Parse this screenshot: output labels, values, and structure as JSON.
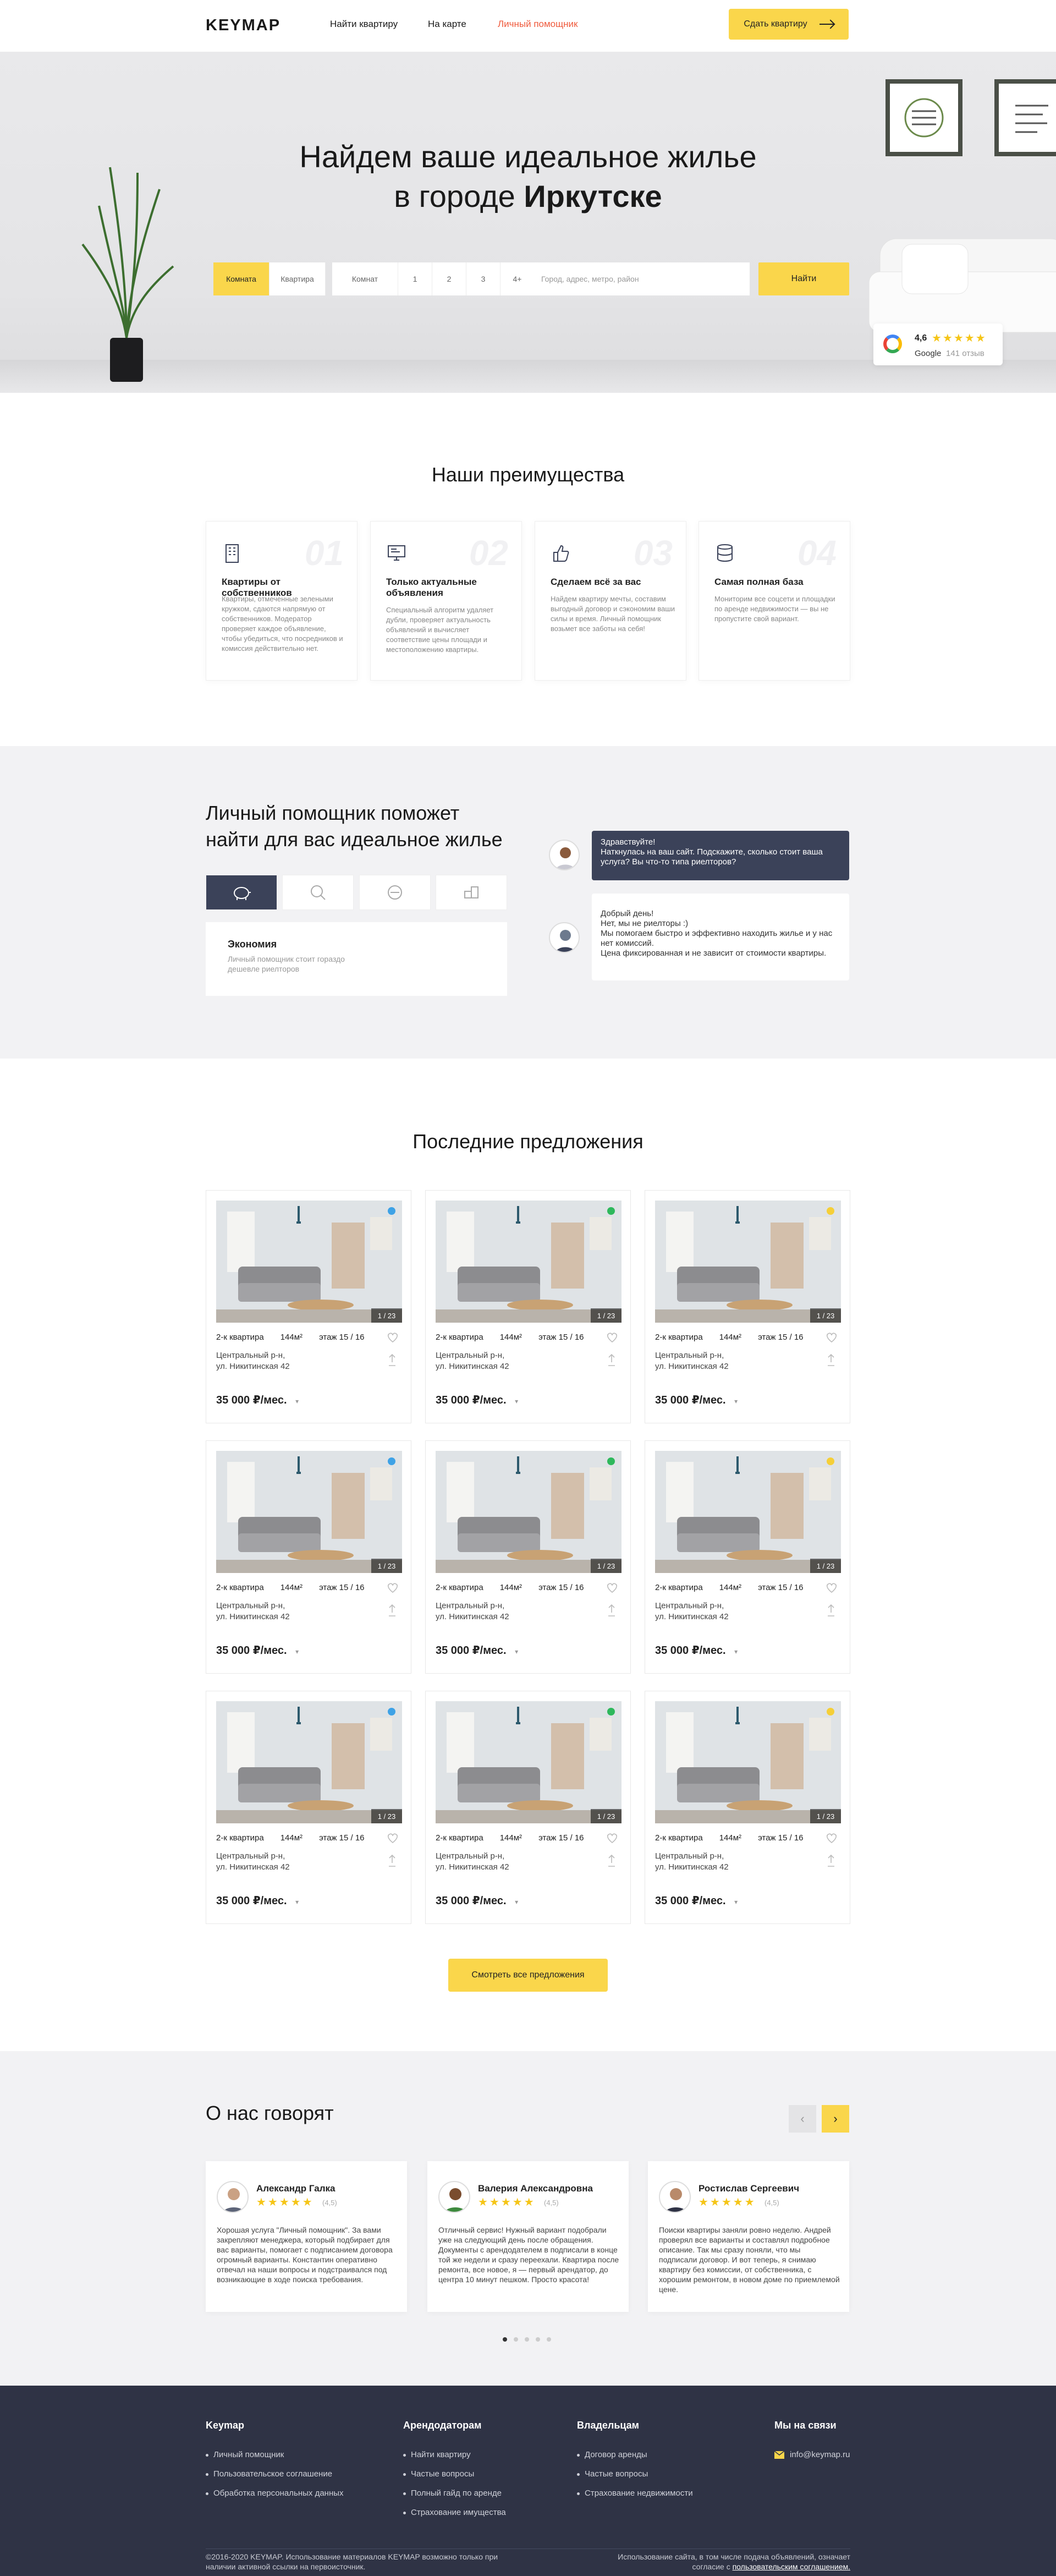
{
  "header": {
    "logo": "KEYMAP",
    "nav": [
      "Найти квартиру",
      "На карте",
      "Личный помощник"
    ],
    "rent_button": "Сдать квартиру"
  },
  "hero": {
    "title_line1": "Найдем ваше идеальное жилье",
    "title_line2_prefix": "в городе ",
    "city": "Иркутске",
    "search": {
      "type_options": [
        "Комната",
        "Квартира"
      ],
      "rooms_label": "Комнат",
      "rooms": [
        "1",
        "2",
        "3",
        "4+"
      ],
      "placeholder": "Город, адрес, метро, район",
      "button": "Найти"
    },
    "google": {
      "rating": "4,6",
      "stars": "★★★★★",
      "name": "Google",
      "reviews": "141 отзыв"
    }
  },
  "advantages": {
    "title": "Наши преимущества",
    "items": [
      {
        "num": "01",
        "title": "Квартиры от собственников",
        "text": "Квартиры, отмеченные зелеными кружком, сдаются напрямую от собственников. Модератор проверяет каждое объявление, чтобы убедиться, что посредников и комиссия действительно нет."
      },
      {
        "num": "02",
        "title": "Только актуальные объявления",
        "text": "Специальный алгоритм удаляет дубли, проверяет актуальность объявлений и вычисляет соответствие цены площади и местоположению квартиры."
      },
      {
        "num": "03",
        "title": "Сделаем всё за вас",
        "text": "Найдем квартиру мечты, составим выгодный договор и сэкономим ваши силы и время. Личный помощник возьмет все заботы на себя!"
      },
      {
        "num": "04",
        "title": "Самая полная база",
        "text": "Мониторим все соцсети и площадки по аренде недвижимости — вы не пропустите свой вариант."
      }
    ]
  },
  "assistant": {
    "title_line1": "Личный помощник поможет",
    "title_line2": "найти для вас идеальное жилье",
    "active_title": "Экономия",
    "active_text": "Личный помощник стоит гораздо дешевле риелторов",
    "question": "Здравствуйте!\nНаткнулась на ваш сайт. Подскажите, сколько стоит ваша услуга? Вы что-то типа риелторов?",
    "answer": "Добрый день!\nНет, мы не риелторы :)\nМы помогаем быстро и эффективно находить жилье и у нас нет комиссий.\nЦена фиксированная и не зависит от стоимости квартиры."
  },
  "offers": {
    "title": "Последние предложения",
    "more_button": "Смотреть все предложения",
    "cards": [
      {
        "rooms": "2-к квартира",
        "area": "144м²",
        "floor": "этаж 15 / 16",
        "district": "Центральный р-н,",
        "street": "ул. Никитинская 42",
        "price": "35 000  ₽/мес.",
        "photos": "1 / 23",
        "dot": "#3ea2e6"
      },
      {
        "rooms": "2-к квартира",
        "area": "144м²",
        "floor": "этаж 15 / 16",
        "district": "Центральный р-н,",
        "street": "ул. Никитинская 42",
        "price": "35 000  ₽/мес.",
        "photos": "1 / 23",
        "dot": "#2eb85c"
      },
      {
        "rooms": "2-к квартира",
        "area": "144м²",
        "floor": "этаж 15 / 16",
        "district": "Центральный р-н,",
        "street": "ул. Никитинская 42",
        "price": "35 000  ₽/мес.",
        "photos": "1 / 23",
        "dot": "#f5cf38"
      },
      {
        "rooms": "2-к квартира",
        "area": "144м²",
        "floor": "этаж 15 / 16",
        "district": "Центральный р-н,",
        "street": "ул. Никитинская 42",
        "price": "35 000  ₽/мес.",
        "photos": "1 / 23",
        "dot": "#3ea2e6"
      },
      {
        "rooms": "2-к квартира",
        "area": "144м²",
        "floor": "этаж 15 / 16",
        "district": "Центральный р-н,",
        "street": "ул. Никитинская 42",
        "price": "35 000  ₽/мес.",
        "photos": "1 / 23",
        "dot": "#2eb85c"
      },
      {
        "rooms": "2-к квартира",
        "area": "144м²",
        "floor": "этаж 15 / 16",
        "district": "Центральный р-н,",
        "street": "ул. Никитинская 42",
        "price": "35 000  ₽/мес.",
        "photos": "1 / 23",
        "dot": "#f5cf38"
      },
      {
        "rooms": "2-к квартира",
        "area": "144м²",
        "floor": "этаж 15 / 16",
        "district": "Центральный р-н,",
        "street": "ул. Никитинская 42",
        "price": "35 000  ₽/мес.",
        "photos": "1 / 23",
        "dot": "#3ea2e6"
      },
      {
        "rooms": "2-к квартира",
        "area": "144м²",
        "floor": "этаж 15 / 16",
        "district": "Центральный р-н,",
        "street": "ул. Никитинская 42",
        "price": "35 000  ₽/мес.",
        "photos": "1 / 23",
        "dot": "#2eb85c"
      },
      {
        "rooms": "2-к квартира",
        "area": "144м²",
        "floor": "этаж 15 / 16",
        "district": "Центральный р-н,",
        "street": "ул. Никитинская 42",
        "price": "35 000  ₽/мес.",
        "photos": "1 / 23",
        "dot": "#f5cf38"
      }
    ]
  },
  "reviews": {
    "title": "О нас говорят",
    "items": [
      {
        "name": "Александр Галка",
        "stars": "★★★★★",
        "score": "(4,5)",
        "text": "Хорошая услуга \"Личный помощник\". За вами закрепляют менеджера, который подбирает для вас варианты, помогает с подписанием договора огромный варианты. Константин оперативно отвечал на наши вопросы и подстраивался под возникающие в ходе поиска требования."
      },
      {
        "name": "Валерия Александровна",
        "stars": "★★★★★",
        "score": "(4,5)",
        "text": "Отличный сервис! Нужный вариант подобрали уже на следующий день после обращения. Документы с арендодателем в подписали в конце той же недели и сразу переехали. Квартира после ремонта, все новое, я — первый арендатор, до центра 10 минут пешком. Просто красота!"
      },
      {
        "name": "Ростислав Сергеевич",
        "stars": "★★★★★",
        "score": "(4,5)",
        "text": "Поиски квартиры заняли ровно неделю. Андрей проверял все варианты и составлял подробное описание. Так мы сразу поняли, что мы подписали договор. И вот теперь, я снимаю квартиру без комиссии, от собственника, с хорошим ремонтом, в новом доме по приемлемой цене."
      }
    ]
  },
  "footer": {
    "col1": {
      "title": "Keymap",
      "links": [
        "Личный помощник",
        "Пользовательское соглашение",
        "Обработка персональных данных"
      ]
    },
    "col2": {
      "title": "Арендодаторам",
      "links": [
        "Найти квартиру",
        "Частые вопросы",
        "Полный гайд по аренде",
        "Страхование имущества"
      ]
    },
    "col3": {
      "title": "Владельцам",
      "links": [
        "Договор аренды",
        "Частые вопросы",
        "Страхование недвижимости"
      ]
    },
    "col4": {
      "title": "Мы на связи",
      "email": "info@keymap.ru"
    },
    "copyright": "©2016-2020 KEYMAP. Использование материалов KEYMAP возможно только при наличии активной ссылки на первоисточник.",
    "terms_prefix": "Использование сайта, в том числе подача объявлений, означает согласие с ",
    "terms_link": "пользовательским соглашением."
  }
}
